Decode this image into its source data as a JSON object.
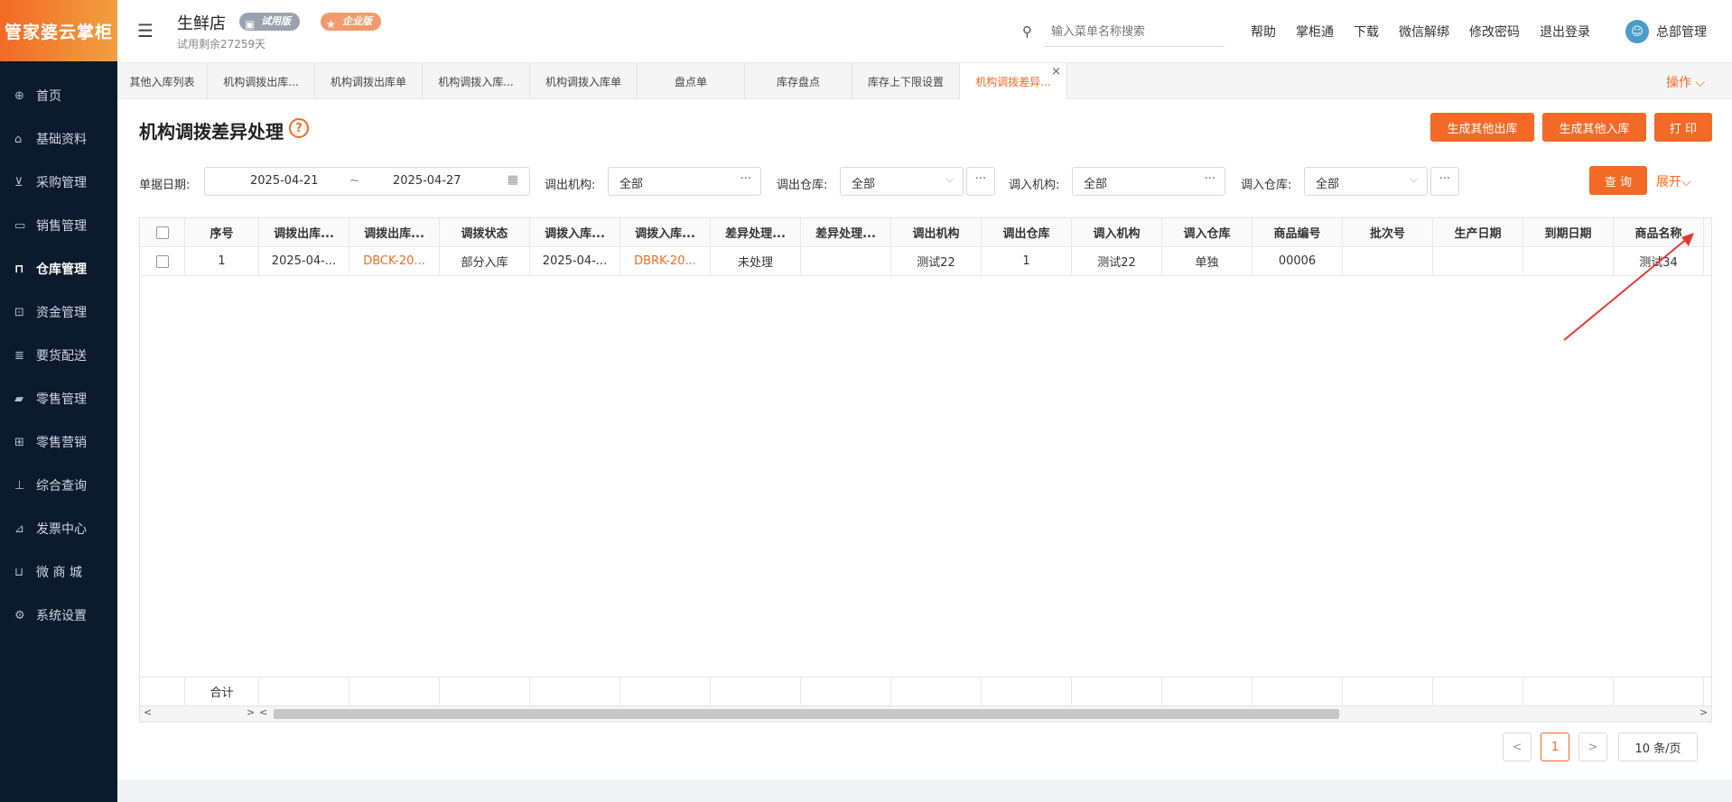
{
  "brand": {
    "logo_text": "管家婆云掌柜"
  },
  "sidebar": {
    "items": [
      {
        "label": "首页",
        "icon": "globe-icon",
        "glyph": "⊕"
      },
      {
        "label": "基础资料",
        "icon": "home-icon",
        "glyph": "⌂"
      },
      {
        "label": "采购管理",
        "icon": "cart-icon",
        "glyph": "⊻"
      },
      {
        "label": "销售管理",
        "icon": "sales-icon",
        "glyph": "▭"
      },
      {
        "label": "仓库管理",
        "icon": "warehouse-icon",
        "glyph": "⊓"
      },
      {
        "label": "资金管理",
        "icon": "money-icon",
        "glyph": "⊡"
      },
      {
        "label": "要货配送",
        "icon": "delivery-icon",
        "glyph": "≣"
      },
      {
        "label": "零售管理",
        "icon": "retail-icon",
        "glyph": "▰"
      },
      {
        "label": "零售营销",
        "icon": "gift-icon",
        "glyph": "⊞"
      },
      {
        "label": "综合查询",
        "icon": "chart-icon",
        "glyph": "⊥"
      },
      {
        "label": "发票中心",
        "icon": "invoice-icon",
        "glyph": "⊿"
      },
      {
        "label": "微 商 城",
        "icon": "bag-icon",
        "glyph": "⊔"
      },
      {
        "label": "系统设置",
        "icon": "gear-icon",
        "glyph": "⚙"
      }
    ]
  },
  "header": {
    "store_name": "生鲜店",
    "badge_trial": "试用版",
    "badge_pro": "企业版",
    "trial_left": "试用剩余27259天",
    "search_placeholder": "输入菜单名称搜索",
    "links": [
      "帮助",
      "掌柜通",
      "下载",
      "微信解绑",
      "修改密码",
      "退出登录"
    ],
    "user_name": "总部管理"
  },
  "tabs": [
    "其他入库列表",
    "机构调拨出库...",
    "机构调拨出库单",
    "机构调拨入库...",
    "机构调拨入库单",
    "盘点单",
    "库存盘点",
    "库存上下限设置",
    "机构调拨差异..."
  ],
  "tabs_ops": "操作 ⌵",
  "page": {
    "title": "机构调拨差异处理",
    "help": "?",
    "buttons": {
      "gen_out": "生成其他出库",
      "gen_in": "生成其他入库",
      "print": "打 印",
      "query": "查 询",
      "expand": "展开⌵"
    }
  },
  "filters": {
    "date_label": "单据日期:",
    "date_from": "2025-04-21",
    "date_sep": "~",
    "date_to": "2025-04-27",
    "out_org_label": "调出机构:",
    "out_org_value": "全部",
    "out_wh_label": "调出仓库:",
    "out_wh_value": "全部",
    "in_org_label": "调入机构:",
    "in_org_value": "全部",
    "in_wh_label": "调入仓库:",
    "in_wh_value": "全部"
  },
  "table": {
    "columns": [
      "序号",
      "调拨出库...",
      "调拨出库...",
      "调拨状态",
      "调拨入库...",
      "调拨入库...",
      "差异处理...",
      "差异处理...",
      "调出机构",
      "调出仓库",
      "调入机构",
      "调入仓库",
      "商品编号",
      "批次号",
      "生产日期",
      "到期日期",
      "商品名称"
    ],
    "rows": [
      [
        "1",
        "2025-04-...",
        "DBCK-20...",
        "部分入库",
        "2025-04-...",
        "DBRK-20...",
        "未处理",
        "",
        "测试22",
        "1",
        "测试22",
        "单独",
        "00006",
        "",
        "",
        "",
        "测试34"
      ]
    ],
    "total_label": "合计"
  },
  "pagination": {
    "current": "1",
    "page_size": "10 条/页"
  }
}
